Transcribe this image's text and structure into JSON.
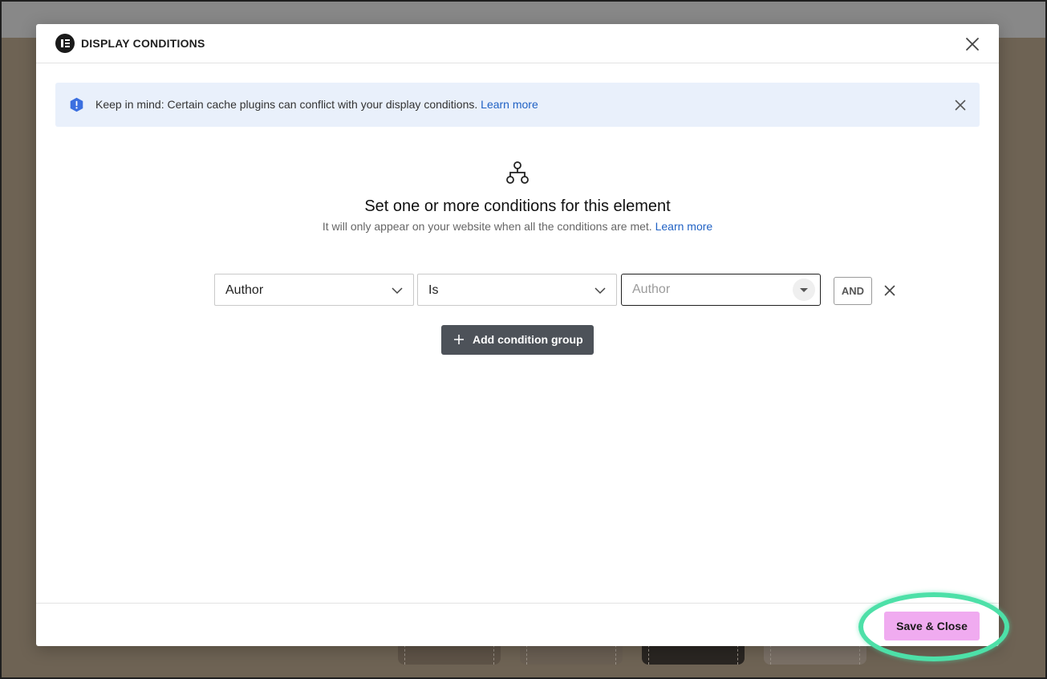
{
  "modal": {
    "title": "DISPLAY CONDITIONS"
  },
  "notice": {
    "text": "Keep in mind: Certain cache plugins can conflict with your display conditions.",
    "link_label": "Learn more"
  },
  "intro": {
    "heading": "Set one or more conditions for this element",
    "subtext": "It will only appear on your website when all the conditions are met.",
    "link_label": "Learn more"
  },
  "condition_row": {
    "field_value": "Author",
    "operator_value": "Is",
    "value_placeholder": "Author",
    "value_current": "",
    "logic_label": "AND"
  },
  "actions": {
    "add_group_label": "Add condition group",
    "save_label": "Save & Close"
  },
  "colors": {
    "accent_save": "#f0abf0",
    "highlight_ring": "#4de0a8",
    "notice_bg": "#e9f0fb",
    "link": "#2162c4",
    "add_group_bg": "#4d5259"
  }
}
